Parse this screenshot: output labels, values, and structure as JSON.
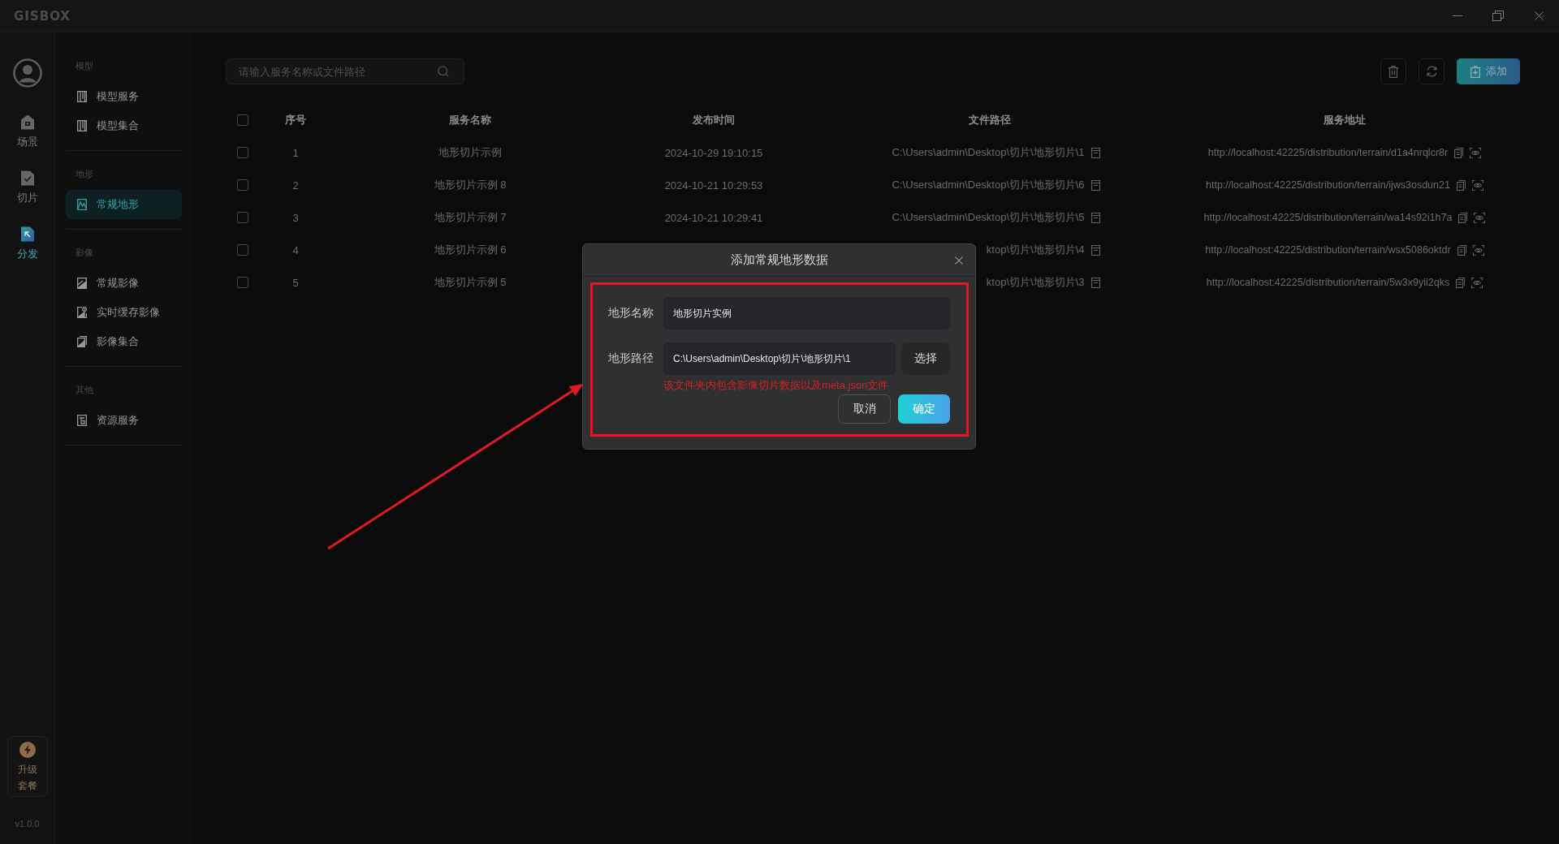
{
  "window": {
    "logo": "GISBOX"
  },
  "rail": {
    "items": [
      {
        "kind": "scene",
        "label": "场景",
        "selected": false
      },
      {
        "kind": "tiles",
        "label": "切片",
        "selected": false
      },
      {
        "kind": "publish",
        "label": "分发",
        "selected": true
      }
    ],
    "upgrade": "升级套餐",
    "version": "v1.0.0"
  },
  "sidebar": {
    "sections": [
      {
        "title": "模型",
        "items": [
          {
            "kind": "model",
            "label": "模型服务",
            "selected": false
          },
          {
            "kind": "model",
            "label": "模型集合",
            "selected": false
          }
        ]
      },
      {
        "title": "地形",
        "items": [
          {
            "kind": "terrain",
            "label": "常规地形",
            "selected": true
          }
        ]
      },
      {
        "title": "影像",
        "items": [
          {
            "kind": "imagery",
            "label": "常规影像",
            "selected": false
          },
          {
            "kind": "live-imagery",
            "label": "实时缓存影像",
            "selected": false
          },
          {
            "kind": "imagery-set",
            "label": "影像集合",
            "selected": false
          }
        ]
      },
      {
        "title": "其他",
        "items": [
          {
            "kind": "resource",
            "label": "资源服务",
            "selected": false
          }
        ]
      }
    ]
  },
  "toolbar": {
    "search": {
      "placeholder": "请输入服务名称或文件路径"
    },
    "add_label": "添加"
  },
  "table": {
    "header_checked": false,
    "columns": [
      "序号",
      "服务名称",
      "发布时间",
      "文件路径",
      "服务地址"
    ],
    "rows": [
      {
        "checked": false,
        "index": "1",
        "name": "地形切片示例",
        "time": "2024-10-29 19:10:15",
        "path": "C:\\Users\\admin\\Desktop\\切片\\地形切片\\1",
        "address": "http://localhost:42225/distribution/terrain/d1a4nrqlcr8r"
      },
      {
        "checked": false,
        "index": "2",
        "name": "地形切片示例 8",
        "time": "2024-10-21 10:29:53",
        "path": "C:\\Users\\admin\\Desktop\\切片\\地形切片\\6",
        "address": "http://localhost:42225/distribution/terrain/ijws3osdun21"
      },
      {
        "checked": false,
        "index": "3",
        "name": "地形切片示例 7",
        "time": "2024-10-21 10:29:41",
        "path": "C:\\Users\\admin\\Desktop\\切片\\地形切片\\5",
        "address": "http://localhost:42225/distribution/terrain/wa14s92i1h7a"
      },
      {
        "checked": false,
        "index": "4",
        "name": "地形切片示例 6",
        "path": "ktop\\切片\\地形切片\\4",
        "address": "http://localhost:42225/distribution/terrain/wsx5086oktdr"
      },
      {
        "checked": false,
        "index": "5",
        "name": "地形切片示例 5",
        "path": "ktop\\切片\\地形切片\\3",
        "address": "http://localhost:42225/distribution/terrain/5w3x9yii2qks"
      }
    ]
  },
  "dialog": {
    "title": "添加常规地形数据",
    "fields": [
      {
        "label": "地形名称",
        "value": "地形切片实例"
      },
      {
        "label": "地形路径",
        "value": "C:\\Users\\admin\\Desktop\\切片\\地形切片\\1",
        "button": "选择",
        "hint": "该文件夹内包含影像切片数据以及meta.json文件"
      }
    ],
    "buttons": [
      {
        "kind": "cancel",
        "label": "取消"
      },
      {
        "kind": "confirm",
        "label": "确定"
      }
    ]
  }
}
